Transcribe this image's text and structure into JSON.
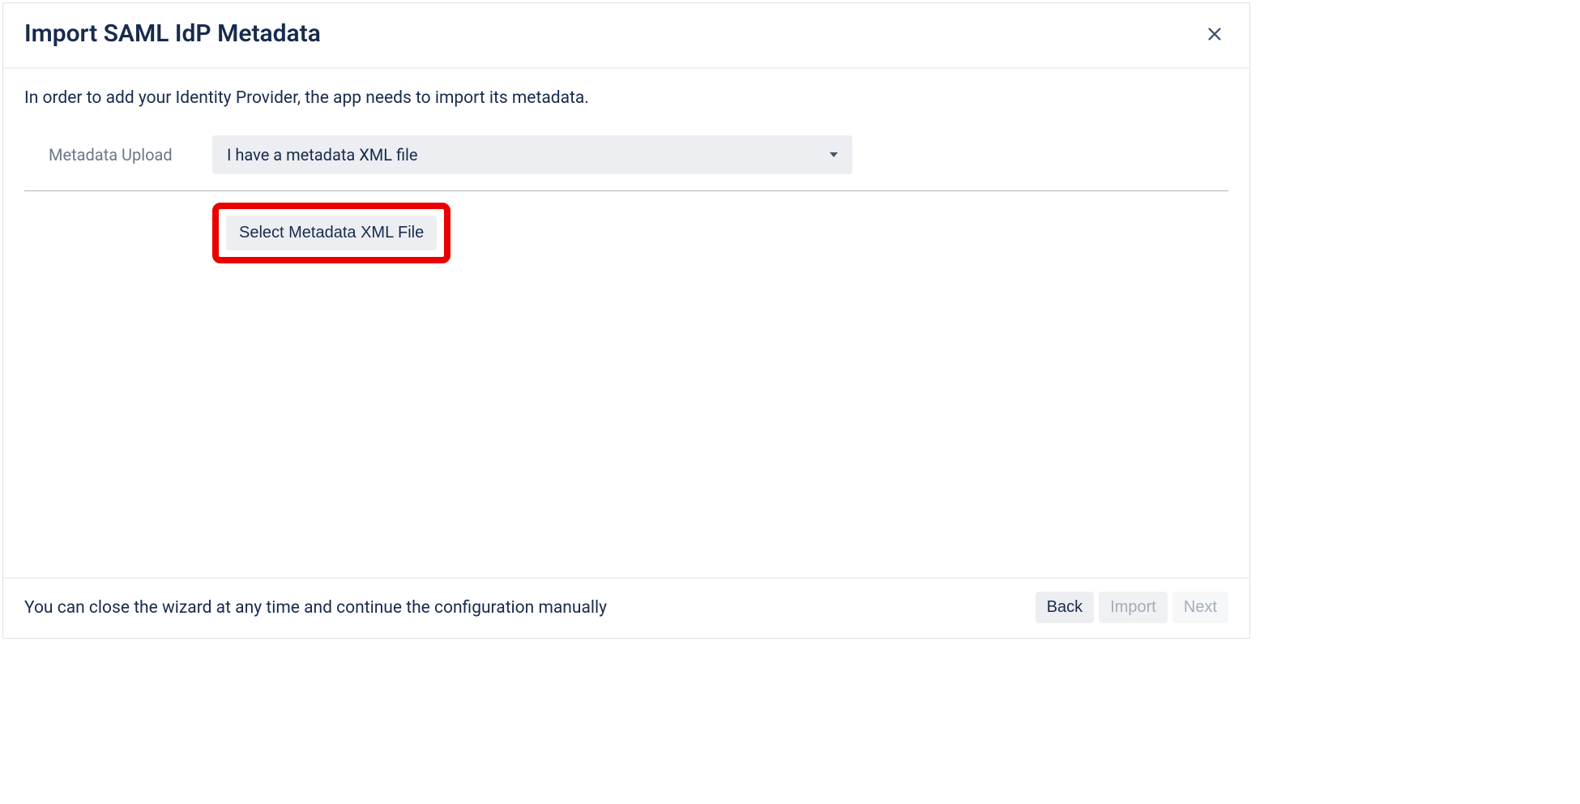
{
  "dialog": {
    "title": "Import SAML IdP Metadata",
    "description": "In order to add your Identity Provider, the app needs to import its metadata."
  },
  "form": {
    "upload_label": "Metadata Upload",
    "upload_selected": "I have a metadata XML file",
    "select_button": "Select Metadata XML File"
  },
  "footer": {
    "hint": "You can close the wizard at any time and continue the configuration manually",
    "back": "Back",
    "import": "Import",
    "next": "Next"
  }
}
